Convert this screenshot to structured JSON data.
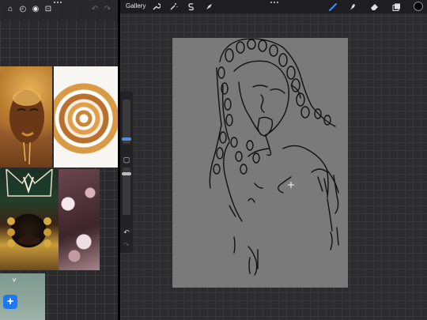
{
  "left_pane": {
    "toolbar": {
      "home_icon": "house-icon",
      "clock_icon": "history-icon",
      "eye_icon": "eye-icon",
      "lock_icon": "unlock-icon",
      "undo_icon": "undo-icon",
      "redo_icon": "redo-icon"
    },
    "images": [
      {
        "name": "gold-face-photo"
      },
      {
        "name": "caramel-swirl-photo"
      },
      {
        "name": "gold-headdress-photo"
      },
      {
        "name": "pink-flowers-photo"
      },
      {
        "name": "sky-photo"
      }
    ],
    "add_button_label": "+"
  },
  "procreate": {
    "top_bar": {
      "gallery_label": "Gallery",
      "actions_icon": "wrench-icon",
      "adjustments_icon": "magic-wand-icon",
      "selection_icon": "selection-s-icon",
      "transform_icon": "cursor-arrow-icon",
      "brush_icon": "brush-icon",
      "smudge_icon": "smudge-icon",
      "eraser_icon": "eraser-icon",
      "layers_icon": "layers-icon",
      "active_tool": "brush",
      "active_color": "#000000",
      "accent_color": "#3e8ef7"
    },
    "sidebar": {
      "brush_size": 0.55,
      "opacity": 0.9,
      "modify_icon": "square-icon",
      "undo_icon": "undo-icon",
      "redo_icon": "redo-icon"
    }
  }
}
